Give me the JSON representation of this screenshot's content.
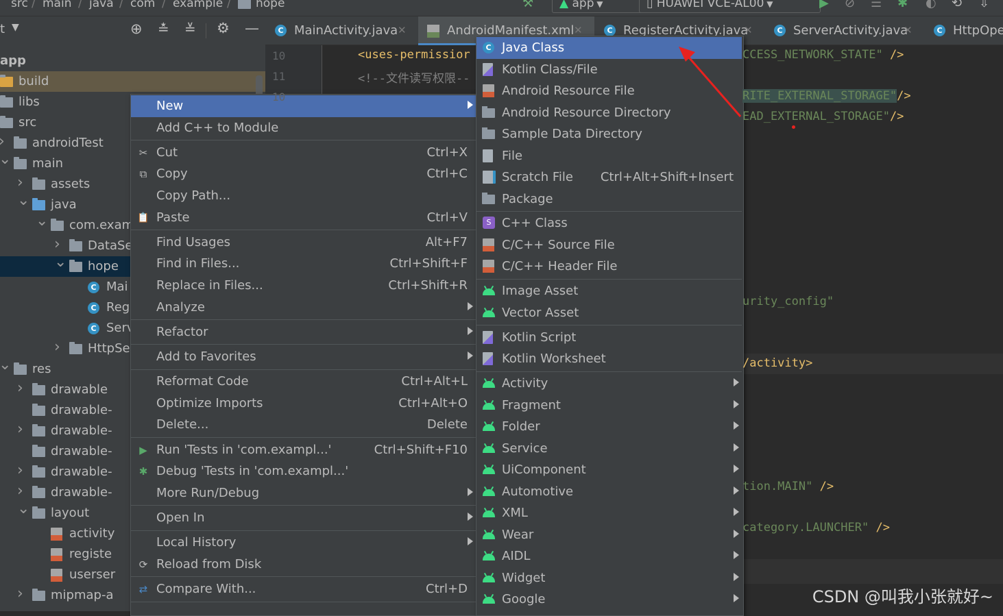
{
  "breadcrumb": [
    "src",
    "main",
    "java",
    "com",
    "example",
    "hope"
  ],
  "toolbar": {
    "config": "app",
    "device": "HUAWEI VCE-AL00"
  },
  "project_panel": {
    "title_fragment": "t",
    "app_label": "app",
    "tree": [
      {
        "label": "build",
        "indent": 0,
        "arrow": "",
        "icon": "folder-orange",
        "selected": false
      },
      {
        "label": "libs",
        "indent": 0,
        "arrow": "",
        "icon": "folder",
        "selected": false
      },
      {
        "label": "src",
        "indent": 0,
        "arrow": "",
        "icon": "folder",
        "selected": false
      },
      {
        "label": "androidTest",
        "indent": 1,
        "arrow": ">",
        "icon": "folder",
        "selected": false
      },
      {
        "label": "main",
        "indent": 1,
        "arrow": "v",
        "icon": "folder",
        "selected": false
      },
      {
        "label": "assets",
        "indent": 2,
        "arrow": ">",
        "icon": "folder",
        "selected": false
      },
      {
        "label": "java",
        "indent": 2,
        "arrow": "v",
        "icon": "folder-blue",
        "selected": false
      },
      {
        "label": "com.exam",
        "indent": 3,
        "arrow": "v",
        "icon": "folder",
        "selected": false
      },
      {
        "label": "DataSe",
        "indent": 4,
        "arrow": ">",
        "icon": "folder",
        "selected": false
      },
      {
        "label": "hope",
        "indent": 4,
        "arrow": "v",
        "icon": "folder",
        "selected": true
      },
      {
        "label": "Mai",
        "indent": 5,
        "arrow": "",
        "icon": "class",
        "selected": false
      },
      {
        "label": "Reg",
        "indent": 5,
        "arrow": "",
        "icon": "class",
        "selected": false
      },
      {
        "label": "Serv",
        "indent": 5,
        "arrow": "",
        "icon": "class",
        "selected": false
      },
      {
        "label": "HttpSe",
        "indent": 4,
        "arrow": ">",
        "icon": "folder",
        "selected": false
      },
      {
        "label": "res",
        "indent": 1,
        "arrow": "v",
        "icon": "folder",
        "selected": false
      },
      {
        "label": "drawable",
        "indent": 2,
        "arrow": ">",
        "icon": "folder",
        "selected": false
      },
      {
        "label": "drawable-",
        "indent": 2,
        "arrow": "",
        "icon": "folder",
        "selected": false
      },
      {
        "label": "drawable-",
        "indent": 2,
        "arrow": ">",
        "icon": "folder",
        "selected": false
      },
      {
        "label": "drawable-",
        "indent": 2,
        "arrow": "",
        "icon": "folder",
        "selected": false
      },
      {
        "label": "drawable-",
        "indent": 2,
        "arrow": ">",
        "icon": "folder",
        "selected": false
      },
      {
        "label": "drawable-",
        "indent": 2,
        "arrow": ">",
        "icon": "folder",
        "selected": false
      },
      {
        "label": "layout",
        "indent": 2,
        "arrow": "v",
        "icon": "folder",
        "selected": false
      },
      {
        "label": "activity",
        "indent": 3,
        "arrow": "",
        "icon": "xml",
        "selected": false
      },
      {
        "label": "registe",
        "indent": 3,
        "arrow": "",
        "icon": "xml",
        "selected": false
      },
      {
        "label": "userser",
        "indent": 3,
        "arrow": "",
        "icon": "xml",
        "selected": false
      },
      {
        "label": "mipmap-a",
        "indent": 2,
        "arrow": ">",
        "icon": "folder",
        "selected": false
      }
    ]
  },
  "tabs": [
    {
      "label": "MainActivity.java",
      "icon": "class",
      "active": false
    },
    {
      "label": "AndroidManifest.xml",
      "icon": "manifest",
      "active": true
    },
    {
      "label": "RegisterActivity.java",
      "icon": "class",
      "active": false
    },
    {
      "label": "ServerActivity.java",
      "icon": "class",
      "active": false
    },
    {
      "label": "HttpOpe",
      "icon": "class",
      "active": false
    }
  ],
  "editor": {
    "line_numbers": [
      "10",
      "11",
      "10"
    ],
    "left_code": [
      "<uses-permissior",
      "<!--文件读写权限--"
    ],
    "right_code": [
      {
        "text": "CCESS_NETWORK_STATE\"",
        "tail": " />"
      },
      {
        "text": "RITE_EXTERNAL_STORAGE\"",
        "tail": "/>"
      },
      {
        "text": "EAD_EXTERNAL_STORAGE\"",
        "tail": "/>"
      },
      {
        "text": "urity_config\"",
        "tail": ""
      },
      {
        "text": "/activity>",
        "tail": ""
      },
      {
        "text": "tion.MAIN\"",
        "tail": " />"
      },
      {
        "text": "category.LAUNCHER\"",
        "tail": " />"
      }
    ]
  },
  "context_menu": [
    {
      "label": "New",
      "shortcut": "",
      "sub": true,
      "icon": "",
      "selected": true,
      "sep_after": false
    },
    {
      "label": "Add C++ to Module",
      "shortcut": "",
      "sub": false,
      "icon": "",
      "selected": false,
      "sep_after": true
    },
    {
      "label": "Cut",
      "shortcut": "Ctrl+X",
      "sub": false,
      "icon": "scissors",
      "selected": false,
      "sep_after": false
    },
    {
      "label": "Copy",
      "shortcut": "Ctrl+C",
      "sub": false,
      "icon": "copy",
      "selected": false,
      "sep_after": false
    },
    {
      "label": "Copy Path...",
      "shortcut": "",
      "sub": false,
      "icon": "",
      "selected": false,
      "sep_after": false
    },
    {
      "label": "Paste",
      "shortcut": "Ctrl+V",
      "sub": false,
      "icon": "paste",
      "selected": false,
      "sep_after": true
    },
    {
      "label": "Find Usages",
      "shortcut": "Alt+F7",
      "sub": false,
      "icon": "",
      "selected": false,
      "sep_after": false
    },
    {
      "label": "Find in Files...",
      "shortcut": "Ctrl+Shift+F",
      "sub": false,
      "icon": "",
      "selected": false,
      "sep_after": false
    },
    {
      "label": "Replace in Files...",
      "shortcut": "Ctrl+Shift+R",
      "sub": false,
      "icon": "",
      "selected": false,
      "sep_after": false
    },
    {
      "label": "Analyze",
      "shortcut": "",
      "sub": true,
      "icon": "",
      "selected": false,
      "sep_after": true
    },
    {
      "label": "Refactor",
      "shortcut": "",
      "sub": true,
      "icon": "",
      "selected": false,
      "sep_after": true
    },
    {
      "label": "Add to Favorites",
      "shortcut": "",
      "sub": true,
      "icon": "",
      "selected": false,
      "sep_after": true
    },
    {
      "label": "Reformat Code",
      "shortcut": "Ctrl+Alt+L",
      "sub": false,
      "icon": "",
      "selected": false,
      "sep_after": false
    },
    {
      "label": "Optimize Imports",
      "shortcut": "Ctrl+Alt+O",
      "sub": false,
      "icon": "",
      "selected": false,
      "sep_after": false
    },
    {
      "label": "Delete...",
      "shortcut": "Delete",
      "sub": false,
      "icon": "",
      "selected": false,
      "sep_after": true
    },
    {
      "label": "Run 'Tests in 'com.exampl...'",
      "shortcut": "Ctrl+Shift+F10",
      "sub": false,
      "icon": "run",
      "selected": false,
      "sep_after": false
    },
    {
      "label": "Debug 'Tests in 'com.exampl...'",
      "shortcut": "",
      "sub": false,
      "icon": "debug",
      "selected": false,
      "sep_after": false
    },
    {
      "label": "More Run/Debug",
      "shortcut": "",
      "sub": true,
      "icon": "",
      "selected": false,
      "sep_after": true
    },
    {
      "label": "Open In",
      "shortcut": "",
      "sub": true,
      "icon": "",
      "selected": false,
      "sep_after": true
    },
    {
      "label": "Local History",
      "shortcut": "",
      "sub": true,
      "icon": "",
      "selected": false,
      "sep_after": false
    },
    {
      "label": "Reload from Disk",
      "shortcut": "",
      "sub": false,
      "icon": "reload",
      "selected": false,
      "sep_after": true
    },
    {
      "label": "Compare With...",
      "shortcut": "Ctrl+D",
      "sub": false,
      "icon": "compare",
      "selected": false,
      "sep_after": true
    }
  ],
  "new_submenu": [
    {
      "label": "Java Class",
      "shortcut": "",
      "sub": false,
      "icon": "class",
      "selected": true,
      "sep_after": false
    },
    {
      "label": "Kotlin Class/File",
      "shortcut": "",
      "sub": false,
      "icon": "kotlin",
      "selected": false,
      "sep_after": false
    },
    {
      "label": "Android Resource File",
      "shortcut": "",
      "sub": false,
      "icon": "res-file",
      "selected": false,
      "sep_after": false
    },
    {
      "label": "Android Resource Directory",
      "shortcut": "",
      "sub": false,
      "icon": "folder",
      "selected": false,
      "sep_after": false
    },
    {
      "label": "Sample Data Directory",
      "shortcut": "",
      "sub": false,
      "icon": "folder",
      "selected": false,
      "sep_after": false
    },
    {
      "label": "File",
      "shortcut": "",
      "sub": false,
      "icon": "file",
      "selected": false,
      "sep_after": false
    },
    {
      "label": "Scratch File",
      "shortcut": "Ctrl+Alt+Shift+Insert",
      "sub": false,
      "icon": "scratch",
      "selected": false,
      "sep_after": false
    },
    {
      "label": "Package",
      "shortcut": "",
      "sub": false,
      "icon": "folder",
      "selected": false,
      "sep_after": true
    },
    {
      "label": "C++ Class",
      "shortcut": "",
      "sub": false,
      "icon": "cpp",
      "selected": false,
      "sep_after": false
    },
    {
      "label": "C/C++ Source File",
      "shortcut": "",
      "sub": false,
      "icon": "res-file",
      "selected": false,
      "sep_after": false
    },
    {
      "label": "C/C++ Header File",
      "shortcut": "",
      "sub": false,
      "icon": "res-file",
      "selected": false,
      "sep_after": true
    },
    {
      "label": "Image Asset",
      "shortcut": "",
      "sub": false,
      "icon": "android",
      "selected": false,
      "sep_after": false
    },
    {
      "label": "Vector Asset",
      "shortcut": "",
      "sub": false,
      "icon": "android",
      "selected": false,
      "sep_after": true
    },
    {
      "label": "Kotlin Script",
      "shortcut": "",
      "sub": false,
      "icon": "kotlin",
      "selected": false,
      "sep_after": false
    },
    {
      "label": "Kotlin Worksheet",
      "shortcut": "",
      "sub": false,
      "icon": "kotlin",
      "selected": false,
      "sep_after": true
    },
    {
      "label": "Activity",
      "shortcut": "",
      "sub": true,
      "icon": "android",
      "selected": false,
      "sep_after": false
    },
    {
      "label": "Fragment",
      "shortcut": "",
      "sub": true,
      "icon": "android",
      "selected": false,
      "sep_after": false
    },
    {
      "label": "Folder",
      "shortcut": "",
      "sub": true,
      "icon": "android",
      "selected": false,
      "sep_after": false
    },
    {
      "label": "Service",
      "shortcut": "",
      "sub": true,
      "icon": "android",
      "selected": false,
      "sep_after": false
    },
    {
      "label": "UiComponent",
      "shortcut": "",
      "sub": true,
      "icon": "android",
      "selected": false,
      "sep_after": false
    },
    {
      "label": "Automotive",
      "shortcut": "",
      "sub": true,
      "icon": "android",
      "selected": false,
      "sep_after": false
    },
    {
      "label": "XML",
      "shortcut": "",
      "sub": true,
      "icon": "android",
      "selected": false,
      "sep_after": false
    },
    {
      "label": "Wear",
      "shortcut": "",
      "sub": true,
      "icon": "android",
      "selected": false,
      "sep_after": false
    },
    {
      "label": "AIDL",
      "shortcut": "",
      "sub": true,
      "icon": "android",
      "selected": false,
      "sep_after": false
    },
    {
      "label": "Widget",
      "shortcut": "",
      "sub": true,
      "icon": "android",
      "selected": false,
      "sep_after": false
    },
    {
      "label": "Google",
      "shortcut": "",
      "sub": true,
      "icon": "android",
      "selected": false,
      "sep_after": false
    }
  ],
  "watermark": "CSDN @叫我小张就好~",
  "colors": {
    "selection": "#4b6eaf",
    "annotation_arrow": "#e8221f",
    "android_green": "#3ddc84",
    "code_tag": "#e8bf6a"
  }
}
